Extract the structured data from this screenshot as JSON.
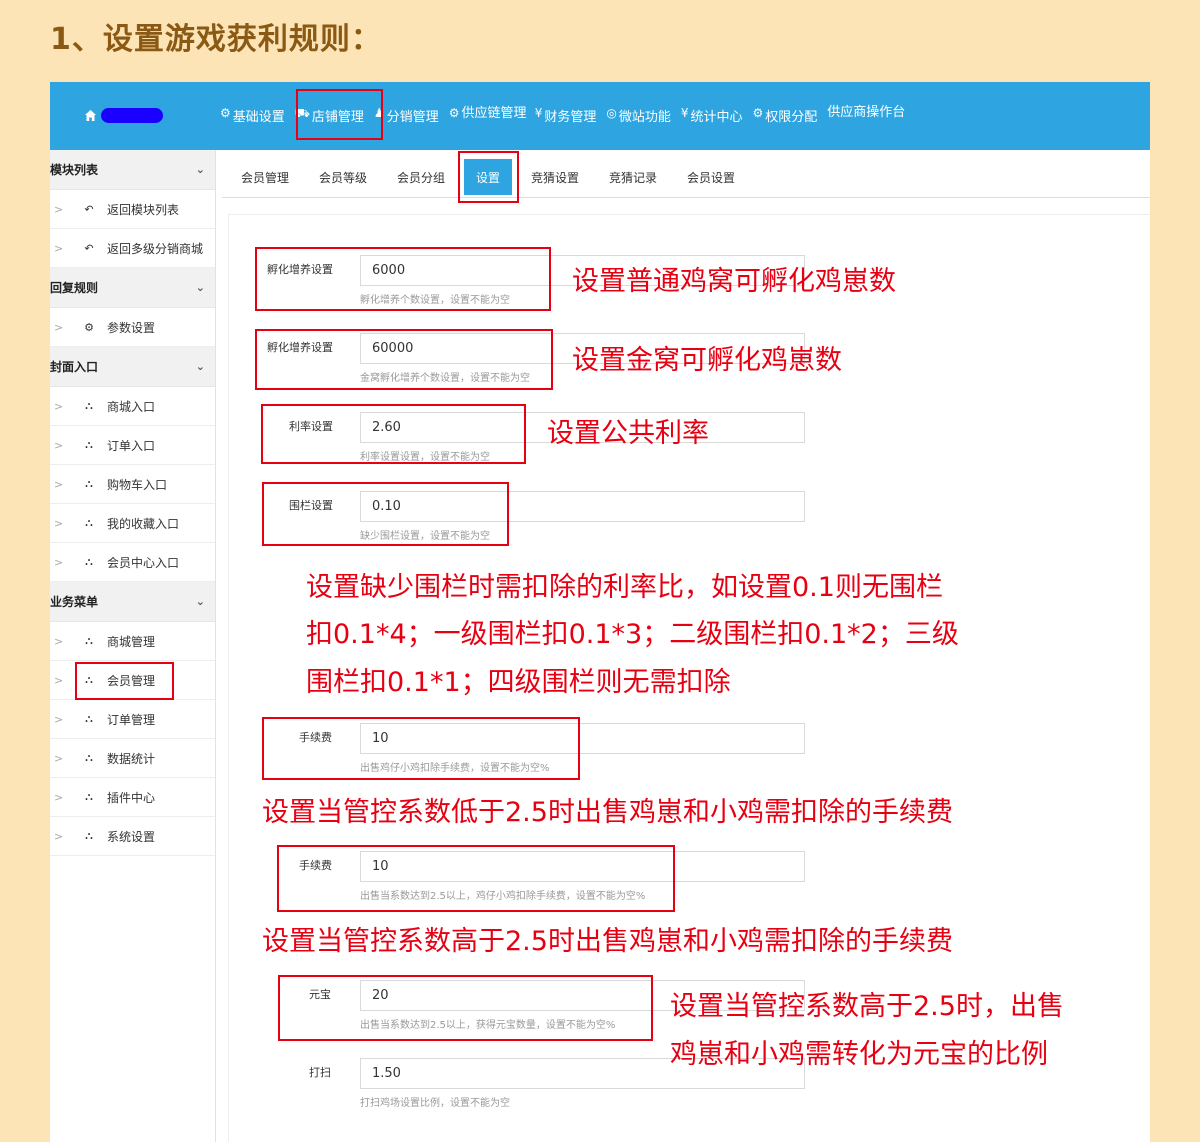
{
  "heading": "1、设置游戏获利规则：",
  "topnav": {
    "items": [
      {
        "icon": "gear-icon",
        "glyph": "⚙",
        "label": "基础设置"
      },
      {
        "icon": "car-icon",
        "glyph": "⛟",
        "label": "店铺管理"
      },
      {
        "icon": "person-icon",
        "glyph": "♟",
        "label": "分销管理"
      },
      {
        "icon": "cogs-icon",
        "glyph": "⚙",
        "label": "供应链管理"
      },
      {
        "icon": "yen-icon",
        "glyph": "¥",
        "label": "财务管理"
      },
      {
        "icon": "globe-icon",
        "glyph": "◎",
        "label": "微站功能"
      },
      {
        "icon": "yen-icon",
        "glyph": "¥",
        "label": "统计中心"
      },
      {
        "icon": "gear-icon",
        "glyph": "⚙",
        "label": "权限分配"
      },
      {
        "icon": "",
        "glyph": "",
        "label": "供应商操作台"
      }
    ]
  },
  "sidebar": {
    "groups": [
      {
        "title": "模块列表",
        "items": [
          {
            "icon": "reply-icon",
            "label": "返回模块列表"
          },
          {
            "icon": "reply-icon",
            "label": "返回多级分销商城"
          }
        ]
      },
      {
        "title": "回复规则",
        "items": [
          {
            "icon": "gear-icon",
            "label": "参数设置"
          }
        ]
      },
      {
        "title": "封面入口",
        "items": [
          {
            "icon": "sitemap-icon",
            "label": "商城入口"
          },
          {
            "icon": "sitemap-icon",
            "label": "订单入口"
          },
          {
            "icon": "sitemap-icon",
            "label": "购物车入口"
          },
          {
            "icon": "sitemap-icon",
            "label": "我的收藏入口"
          },
          {
            "icon": "sitemap-icon",
            "label": "会员中心入口"
          }
        ]
      },
      {
        "title": "业务菜单",
        "items": [
          {
            "icon": "sitemap-icon",
            "label": "商城管理"
          },
          {
            "icon": "sitemap-icon",
            "label": "会员管理"
          },
          {
            "icon": "sitemap-icon",
            "label": "订单管理"
          },
          {
            "icon": "sitemap-icon",
            "label": "数据统计"
          },
          {
            "icon": "sitemap-icon",
            "label": "插件中心"
          },
          {
            "icon": "sitemap-icon",
            "label": "系统设置"
          }
        ]
      }
    ]
  },
  "tabs": [
    "会员管理",
    "会员等级",
    "会员分组",
    "设置",
    "竞猜设置",
    "竞猜记录",
    "会员设置"
  ],
  "active_tab": "设置",
  "form": [
    {
      "label": "孵化增养设置",
      "value": "6000",
      "help": "孵化增养个数设置，设置不能为空"
    },
    {
      "label": "孵化增养设置",
      "value": "60000",
      "help": "金窝孵化增养个数设置，设置不能为空"
    },
    {
      "label": "利率设置",
      "value": "2.60",
      "help": "利率设置设置，设置不能为空"
    },
    {
      "label": "围栏设置",
      "value": "0.10",
      "help": "缺少围栏设置，设置不能为空"
    },
    {
      "label": "手续费",
      "value": "10",
      "help": "出售鸡仔小鸡扣除手续费，设置不能为空%"
    },
    {
      "label": "手续费",
      "value": "10",
      "help": "出售当系数达到2.5以上，鸡仔小鸡扣除手续费，设置不能为空%"
    },
    {
      "label": "元宝",
      "value": "20",
      "help": "出售当系数达到2.5以上，获得元宝数量，设置不能为空%"
    },
    {
      "label": "打扫",
      "value": "1.50",
      "help": "打扫鸡场设置比例，设置不能为空"
    }
  ],
  "annotations": {
    "a1": "设置普通鸡窝可孵化鸡崽数",
    "a2": "设置金窝可孵化鸡崽数",
    "a3": "设置公共利率",
    "a4": [
      "设置缺少围栏时需扣除的利率比，如设置0.1则无围栏",
      "扣0.1*4；一级围栏扣0.1*3；二级围栏扣0.1*2；三级",
      "围栏扣0.1*1；四级围栏则无需扣除"
    ],
    "a5": "设置当管控系数低于2.5时出售鸡崽和小鸡需扣除的手续费",
    "a6": "设置当管控系数高于2.5时出售鸡崽和小鸡需扣除的手续费",
    "a7": [
      "设置当管控系数高于2.5时，出售",
      "鸡崽和小鸡需转化为元宝的比例"
    ]
  },
  "colors": {
    "accent": "#2ea5e0",
    "annotation": "#e60012",
    "background": "#fde4b6",
    "heading": "#8a5a14"
  }
}
